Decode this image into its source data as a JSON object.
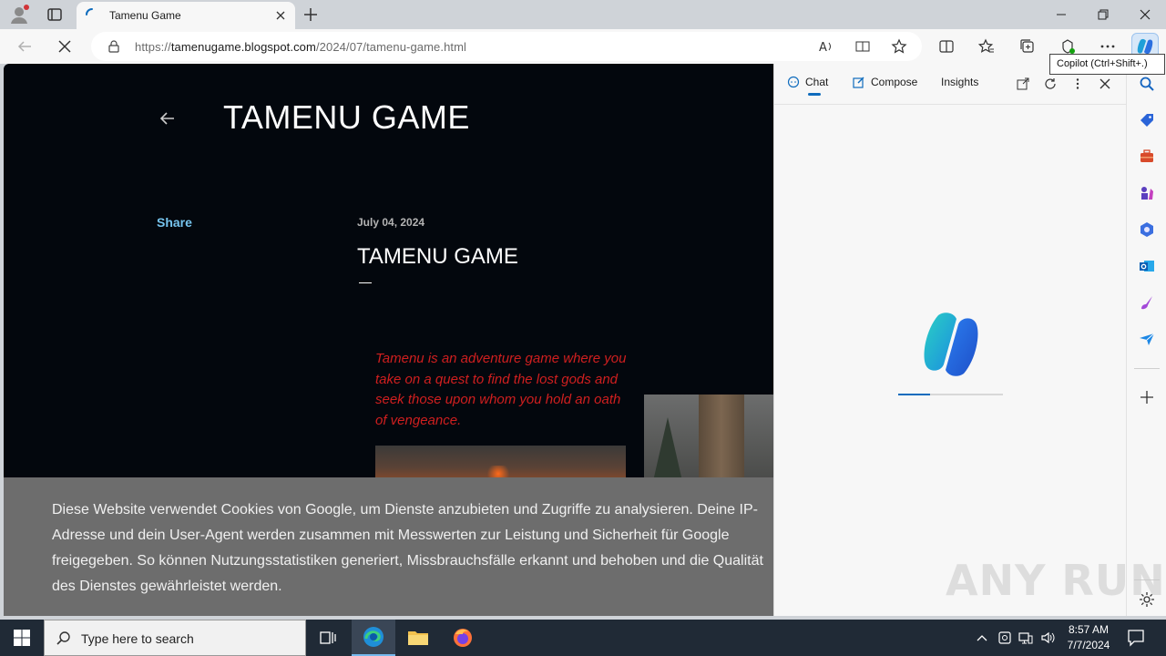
{
  "browser": {
    "tab_title": "Tamenu Game",
    "url_scheme": "https://",
    "url_host": "tamenugame.blogspot.com",
    "url_path": "/2024/07/tamenu-game.html",
    "copilot_tooltip": "Copilot (Ctrl+Shift+.)"
  },
  "page": {
    "blog_title": "TAMENU GAME",
    "share_label": "Share",
    "post_date": "July 04, 2024",
    "post_title": "TAMENU GAME",
    "post_intro": "Tamenu is an adventure game where you take on a quest to find the lost gods and seek those upon whom you hold an oath of vengeance.",
    "cookie_text": "Diese Website verwendet Cookies von Google, um Dienste anzubieten und Zugriffe zu analysieren. Deine IP-Adresse und dein User-Agent werden zusammen mit Messwerten zur Leistung und Sicherheit für Google freigegeben. So können Nutzungsstatistiken generiert, Missbrauchsfälle erkannt und behoben und die Qualität des Dienstes gewährleistet werden."
  },
  "copilot": {
    "tab_chat": "Chat",
    "tab_compose": "Compose",
    "tab_insights": "Insights",
    "loading_progress": 0.3
  },
  "watermark": "ANY RUN",
  "taskbar": {
    "search_placeholder": "Type here to search",
    "time": "8:57 AM",
    "date": "7/7/2024"
  },
  "colors": {
    "page_bg": "#03070d",
    "intro_text": "#d01f1f",
    "share_link": "#76c4ee",
    "accent": "#0f6cbd"
  }
}
